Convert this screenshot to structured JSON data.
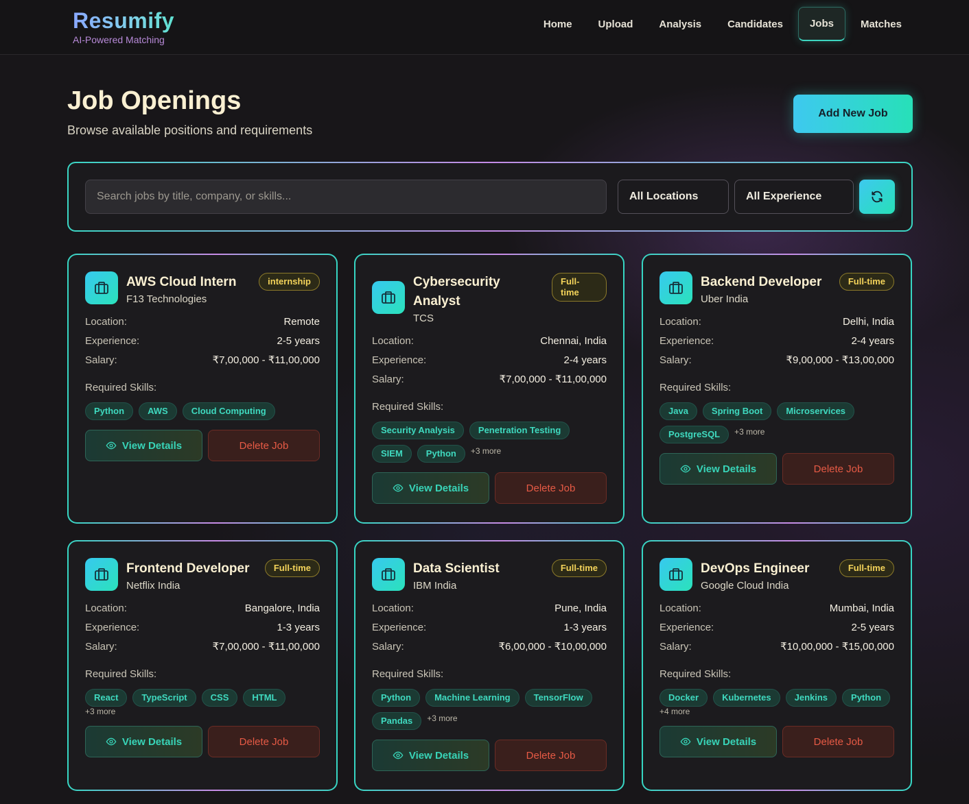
{
  "brand": {
    "name": "Resumify",
    "tagline": "AI-Powered Matching"
  },
  "nav": {
    "home": "Home",
    "upload": "Upload",
    "analysis": "Analysis",
    "candidates": "Candidates",
    "jobs": "Jobs",
    "matches": "Matches",
    "active": "Jobs"
  },
  "header": {
    "title": "Job Openings",
    "subtitle": "Browse available positions and requirements",
    "add_button": "Add New Job"
  },
  "filters": {
    "search_placeholder": "Search jobs by title, company, or skills...",
    "location": "All Locations",
    "experience": "All Experience",
    "refresh_icon": "refresh-icon"
  },
  "labels": {
    "location": "Location:",
    "experience": "Experience:",
    "salary": "Salary:",
    "skills": "Required Skills:",
    "view": "View Details",
    "delete": "Delete Job"
  },
  "colors": {
    "accent_teal": "#3dd6c1",
    "accent_purple": "#c58be6",
    "badge_yellow": "#f3d35a",
    "delete_red": "#e65a45"
  },
  "jobs": [
    {
      "title": "AWS Cloud Intern",
      "company": "F13 Technologies",
      "type": "internship",
      "location": "Remote",
      "experience": "2-5 years",
      "salary": "₹7,00,000 - ₹11,00,000",
      "skills": [
        "Python",
        "AWS",
        "Cloud Computing"
      ],
      "more": ""
    },
    {
      "title": "Cybersecurity Analyst",
      "company": "TCS",
      "type": "Full-time",
      "location": "Chennai, India",
      "experience": "2-4 years",
      "salary": "₹7,00,000 - ₹11,00,000",
      "skills": [
        "Security Analysis",
        "Penetration Testing",
        "SIEM",
        "Python"
      ],
      "more": "+3 more"
    },
    {
      "title": "Backend Developer",
      "company": "Uber India",
      "type": "Full-time",
      "location": "Delhi, India",
      "experience": "2-4 years",
      "salary": "₹9,00,000 - ₹13,00,000",
      "skills": [
        "Java",
        "Spring Boot",
        "Microservices",
        "PostgreSQL"
      ],
      "more": "+3 more"
    },
    {
      "title": "Frontend Developer",
      "company": "Netflix India",
      "type": "Full-time",
      "location": "Bangalore, India",
      "experience": "1-3 years",
      "salary": "₹7,00,000 - ₹11,00,000",
      "skills": [
        "React",
        "TypeScript",
        "CSS",
        "HTML"
      ],
      "more": "+3 more"
    },
    {
      "title": "Data Scientist",
      "company": "IBM India",
      "type": "Full-time",
      "location": "Pune, India",
      "experience": "1-3 years",
      "salary": "₹6,00,000 - ₹10,00,000",
      "skills": [
        "Python",
        "Machine Learning",
        "TensorFlow",
        "Pandas"
      ],
      "more": "+3 more"
    },
    {
      "title": "DevOps Engineer",
      "company": "Google Cloud India",
      "type": "Full-time",
      "location": "Mumbai, India",
      "experience": "2-5 years",
      "salary": "₹10,00,000 - ₹15,00,000",
      "skills": [
        "Docker",
        "Kubernetes",
        "Jenkins",
        "Python"
      ],
      "more": "+4 more"
    }
  ]
}
